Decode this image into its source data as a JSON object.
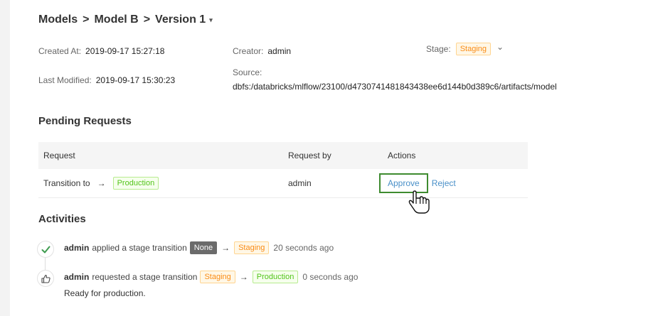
{
  "breadcrumb": {
    "items": [
      "Models",
      "Model B",
      "Version 1"
    ],
    "separator": ">",
    "caret": "▾"
  },
  "meta": {
    "created_at_label": "Created At:",
    "created_at": "2019-09-17 15:27:18",
    "creator_label": "Creator:",
    "creator": "admin",
    "stage_label": "Stage:",
    "stage": "Staging",
    "stage_caret": "⌄",
    "last_modified_label": "Last Modified:",
    "last_modified": "2019-09-17 15:30:23",
    "source_label": "Source:",
    "source": "dbfs:/databricks/mlflow/23100/d4730741481843438ee6d144b0d389c6/artifacts/model"
  },
  "pending": {
    "title": "Pending Requests",
    "columns": [
      "Request",
      "Request by",
      "Actions"
    ],
    "rows": [
      {
        "request_text": "Transition to",
        "arrow": "→",
        "target_stage": "Production",
        "request_by": "admin",
        "approve": "Approve",
        "reject": "Reject"
      }
    ]
  },
  "activities": {
    "title": "Activities",
    "items": [
      {
        "icon": "check-icon",
        "user": "admin",
        "action": "applied a stage transition",
        "from": "None",
        "arrow": "→",
        "to": "Staging",
        "time": "20 seconds ago"
      },
      {
        "icon": "thumbs-up-icon",
        "user": "admin",
        "action": "requested a stage transition",
        "from": "Staging",
        "arrow": "→",
        "to": "Production",
        "time": "0 seconds ago",
        "comment": "Ready for production."
      }
    ]
  },
  "colors": {
    "staging": "#fa8c16",
    "production": "#52c41a",
    "link": "#4a90c8",
    "approve_border": "#3e8b2f"
  }
}
